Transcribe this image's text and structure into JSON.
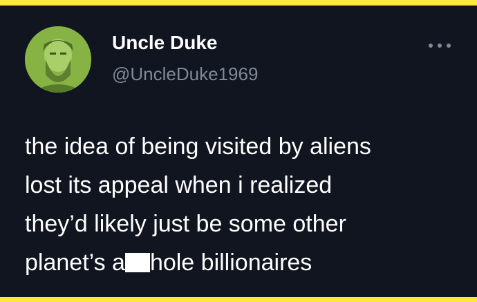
{
  "colors": {
    "page_border": "#fbea3c",
    "background": "#101520",
    "display_name": "#ffffff",
    "handle": "#7f8a96",
    "body_text": "#ffffff",
    "avatar_tint": "#7aa83a"
  },
  "tweet": {
    "author": {
      "display_name": "Uncle Duke",
      "handle": "@UncleDuke1969",
      "avatar_icon": "profile-avatar"
    },
    "more_icon": "ellipsis-icon",
    "text": {
      "line1": "the idea of being visited by aliens",
      "line2": "lost its appeal when i realized",
      "line3": "they’d likely just be some other",
      "line4_before": "planet’s a",
      "line4_after": "hole billionaires"
    }
  }
}
